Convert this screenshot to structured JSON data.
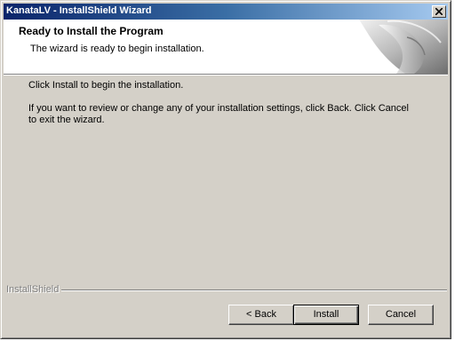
{
  "window": {
    "title": "KanataLV - InstallShield Wizard",
    "close_label": "×"
  },
  "header": {
    "title": "Ready to Install the Program",
    "subtitle": "The wizard is ready to begin installation."
  },
  "body": {
    "line1": "Click Install to begin the installation.",
    "line2": "If you want to review or change any of your installation settings, click Back. Click Cancel to exit the wizard."
  },
  "footer": {
    "brand": "InstallShield"
  },
  "buttons": {
    "back": "< Back",
    "install": "Install",
    "cancel": "Cancel"
  },
  "colors": {
    "titlebar_start": "#0a246a",
    "titlebar_end": "#a6caf0",
    "dialog_bg": "#d4d0c8"
  },
  "icons": {
    "close": "close-icon",
    "header_art": "installshield-art"
  }
}
